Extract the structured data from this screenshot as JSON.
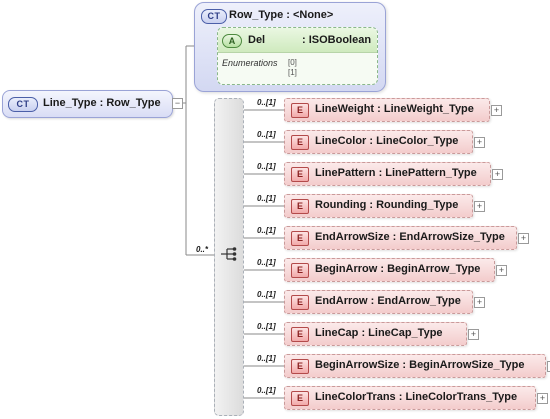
{
  "root": {
    "badge": "CT",
    "title": "Line_Type : Row_Type"
  },
  "row_type": {
    "badge": "CT",
    "title": "Row_Type : <None>",
    "attribute": {
      "badge": "A",
      "name": "Del",
      "type": ": ISOBoolean"
    },
    "enumerations_label": "Enumerations",
    "enumerations": [
      "[0]",
      "[1]"
    ]
  },
  "sequence": {
    "cardinality": "0..*"
  },
  "elements": [
    {
      "badge": "E",
      "label": "LineWeight : LineWeight_Type",
      "cardinality": "0..[1]"
    },
    {
      "badge": "E",
      "label": "LineColor : LineColor_Type",
      "cardinality": "0..[1]"
    },
    {
      "badge": "E",
      "label": "LinePattern : LinePattern_Type",
      "cardinality": "0..[1]"
    },
    {
      "badge": "E",
      "label": "Rounding : Rounding_Type",
      "cardinality": "0..[1]"
    },
    {
      "badge": "E",
      "label": "EndArrowSize : EndArrowSize_Type",
      "cardinality": "0..[1]"
    },
    {
      "badge": "E",
      "label": "BeginArrow : BeginArrow_Type",
      "cardinality": "0..[1]"
    },
    {
      "badge": "E",
      "label": "EndArrow : EndArrow_Type",
      "cardinality": "0..[1]"
    },
    {
      "badge": "E",
      "label": "LineCap : LineCap_Type",
      "cardinality": "0..[1]"
    },
    {
      "badge": "E",
      "label": "BeginArrowSize : BeginArrowSize_Type",
      "cardinality": "0..[1]"
    },
    {
      "badge": "E",
      "label": "LineColorTrans : LineColorTrans_Type",
      "cardinality": "0..[1]"
    }
  ],
  "expand_symbol": "+",
  "collapse_symbol": "−"
}
